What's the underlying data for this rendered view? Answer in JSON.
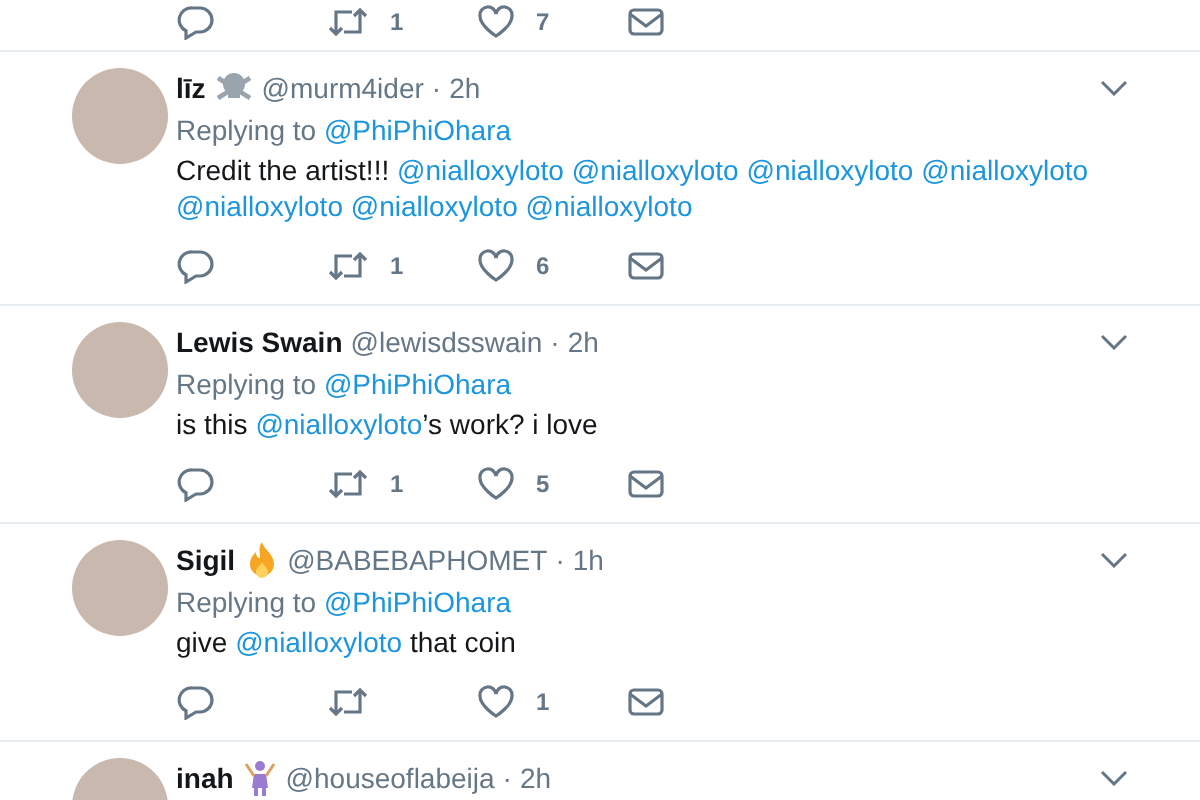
{
  "top_actions": {
    "retweets": "1",
    "likes": "7"
  },
  "tweets": [
    {
      "name": "līz",
      "badge": {
        "kind": "skull"
      },
      "handle": "@murm4ider",
      "separator": "·",
      "time": "2h",
      "replying_label": "Replying to",
      "replying_to": "@PhiPhiOhara",
      "body": [
        {
          "kind": "text",
          "text": "Credit the artist!!! "
        },
        {
          "kind": "mention",
          "text": "@nialloxyloto"
        },
        {
          "kind": "mention",
          "text": "@nialloxyloto"
        },
        {
          "kind": "mention",
          "text": "@nialloxyloto"
        },
        {
          "kind": "mention",
          "text": "@nialloxyloto"
        },
        {
          "kind": "mention",
          "text": "@nialloxyloto"
        },
        {
          "kind": "mention",
          "text": "@nialloxyloto"
        },
        {
          "kind": "mention",
          "text": "@nialloxyloto"
        }
      ],
      "actions": {
        "retweets": "1",
        "likes": "6"
      }
    },
    {
      "name": "Lewis Swain",
      "handle": "@lewisdsswain",
      "separator": "·",
      "time": "2h",
      "replying_label": "Replying to",
      "replying_to": "@PhiPhiOhara",
      "body": [
        {
          "kind": "text",
          "text": "is this "
        },
        {
          "kind": "mention",
          "text": "@nialloxyloto"
        },
        {
          "kind": "text",
          "text": "’s work? i love"
        }
      ],
      "actions": {
        "retweets": "1",
        "likes": "5"
      }
    },
    {
      "name": "Sigil",
      "badge": {
        "kind": "fire"
      },
      "handle": "@BABEBAPHOMET",
      "separator": "·",
      "time": "1h",
      "replying_label": "Replying to",
      "replying_to": "@PhiPhiOhara",
      "body": [
        {
          "kind": "text",
          "text": "give "
        },
        {
          "kind": "mention",
          "text": "@nialloxyloto"
        },
        {
          "kind": "text",
          "text": " that coin"
        }
      ],
      "actions": {
        "likes": "1"
      }
    },
    {
      "name": "inah",
      "badge": {
        "kind": "dancer"
      },
      "handle": "@houseoflabeija",
      "separator": "·",
      "time": "2h"
    }
  ]
}
